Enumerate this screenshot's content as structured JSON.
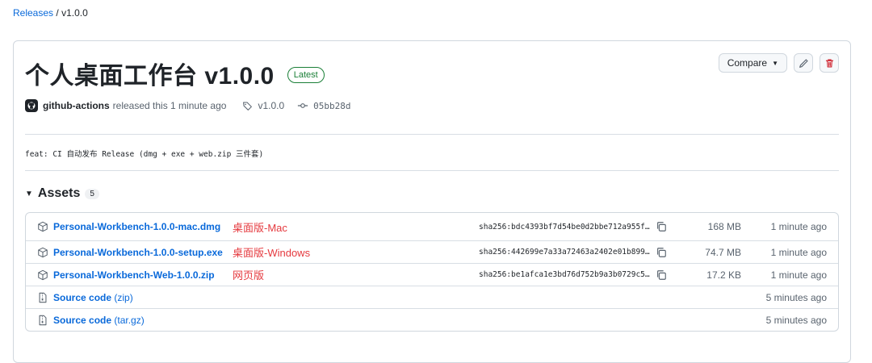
{
  "breadcrumb": {
    "link": "Releases",
    "separator": "/",
    "current": "v1.0.0"
  },
  "release": {
    "title": "个人桌面工作台 v1.0.0",
    "badge": "Latest",
    "compare_label": "Compare",
    "author": "github-actions",
    "released_text": "released this 1 minute ago",
    "tag": "v1.0.0",
    "commit": "05bb28d",
    "description": "feat: CI 自动发布 Release (dmg + exe + web.zip 三件套)"
  },
  "assets": {
    "title": "Assets",
    "count": "5",
    "rows": [
      {
        "icon": "package-icon",
        "name": "Personal-Workbench-1.0.0-mac.dmg",
        "sub": "",
        "note": "桌面版-Mac",
        "sha": "sha256:bdc4393bf7d54be0d2bbe712a955f…",
        "size": "168 MB",
        "time": "1 minute ago"
      },
      {
        "icon": "package-icon",
        "name": "Personal-Workbench-1.0.0-setup.exe",
        "sub": "",
        "note": "桌面版-Windows",
        "sha": "sha256:442699e7a33a72463a2402e01b899…",
        "size": "74.7 MB",
        "time": "1 minute ago"
      },
      {
        "icon": "package-icon",
        "name": "Personal-Workbench-Web-1.0.0.zip",
        "sub": "",
        "note": "网页版",
        "sha": "sha256:be1afca1e3bd76d752b9a3b0729c5…",
        "size": "17.2 KB",
        "time": "1 minute ago"
      },
      {
        "icon": "file-zip-icon",
        "name": "Source code",
        "sub": " (zip)",
        "note": "",
        "sha": "",
        "size": "",
        "time": "5 minutes ago"
      },
      {
        "icon": "file-zip-icon",
        "name": "Source code",
        "sub": " (tar.gz)",
        "note": "",
        "sha": "",
        "size": "",
        "time": "5 minutes ago"
      }
    ]
  },
  "colors": {
    "link": "#0969da",
    "latest": "#1a7f37",
    "delete": "#cf222e",
    "annotation": "#e5393e"
  }
}
